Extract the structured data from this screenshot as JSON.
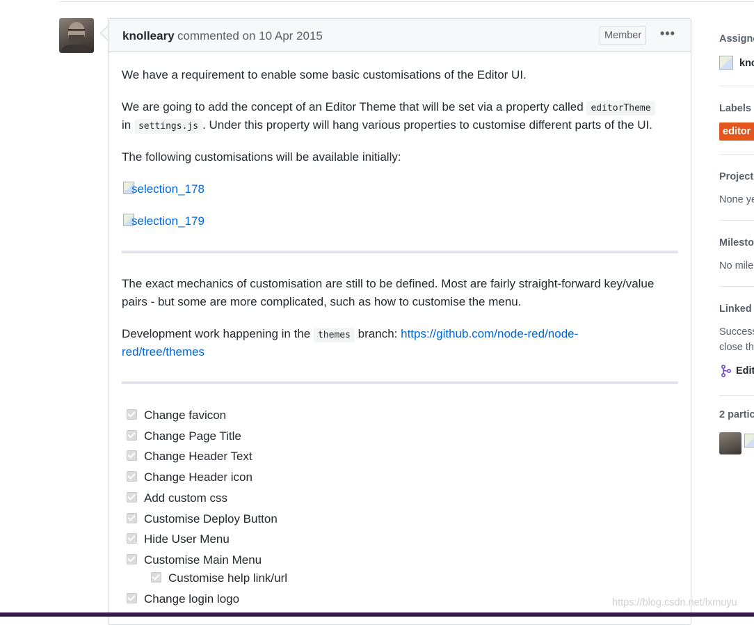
{
  "comment": {
    "author": "knolleary",
    "meta": "commented on 10 Apr 2015",
    "role_badge": "Member",
    "more_label": "•••",
    "paragraphs": {
      "p1": "We have a requirement to enable some basic customisations of the Editor UI.",
      "p2a": "We are going to add the concept of an Editor Theme that will be set via a property called",
      "p2_code1": "editorTheme",
      "p2b": "in",
      "p2_code2": "settings.js",
      "p2c": ". Under this property will hang various properties to customise different parts of the UI.",
      "p3": "The following customisations will be available initially:",
      "img1_alt": "selection_178",
      "img2_alt": "selection_179",
      "p4_line1": "The exact mechanics of customisation are still to be defined. Most are fairly straight-forward key/value",
      "p4_line2": "pairs - but some are more complicated, such as how to customise the menu.",
      "p5a": "Development work happening in the",
      "p5_code": "themes",
      "p5b": "branch:",
      "p5_link_line1": "https://github.com/node-red/node-",
      "p5_link_line2": "red/tree/themes"
    },
    "tasks": [
      {
        "label": "Change favicon",
        "checked": true
      },
      {
        "label": "Change Page Title",
        "checked": true
      },
      {
        "label": "Change Header Text",
        "checked": true
      },
      {
        "label": "Change Header icon",
        "checked": true
      },
      {
        "label": "Add custom css",
        "checked": true
      },
      {
        "label": "Customise Deploy Button",
        "checked": true
      },
      {
        "label": "Hide User Menu",
        "checked": true
      },
      {
        "label": "Customise Main Menu",
        "checked": true
      },
      {
        "label": "Customise help link/url",
        "checked": true
      },
      {
        "label": "Change login logo",
        "checked": true
      }
    ]
  },
  "sidebar": {
    "assignees_title": "Assigne",
    "assignee_name": "knc",
    "labels_title": "Labels",
    "label_name": "editor",
    "label_color": "#e4561b",
    "projects_title": "Projects",
    "projects_value": "None ye",
    "milestone_title": "Milesto",
    "milestone_value": "No mile",
    "linked_title": "Linked",
    "linked_text1": "Success",
    "linked_text2": "close th",
    "linked_edit": "Edit",
    "participants_title": "2 partic"
  },
  "watermark": "https://blog.csdn.net/lxmuyu"
}
